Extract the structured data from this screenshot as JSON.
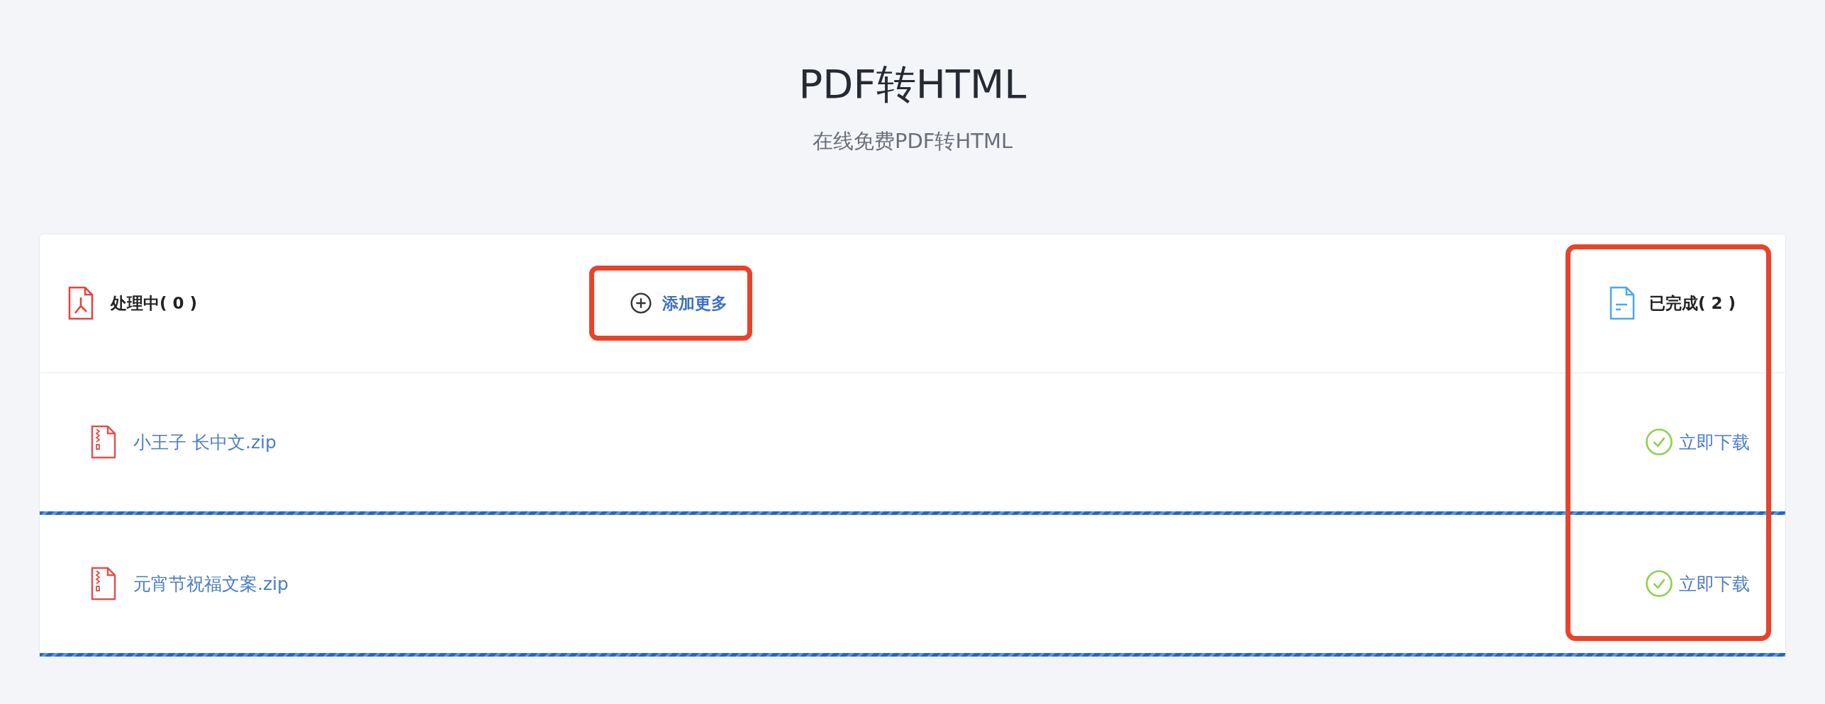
{
  "title": "PDF转HTML",
  "subtitle": "在线免费PDF转HTML",
  "processing": {
    "label": "处理中( 0 )"
  },
  "add_more": {
    "label": "添加更多"
  },
  "completed": {
    "label": "已完成( 2 )"
  },
  "files": [
    {
      "name": "小王子 长中文.zip",
      "action": "立即下载"
    },
    {
      "name": "元宵节祝福文案.zip",
      "action": "立即下载"
    }
  ]
}
